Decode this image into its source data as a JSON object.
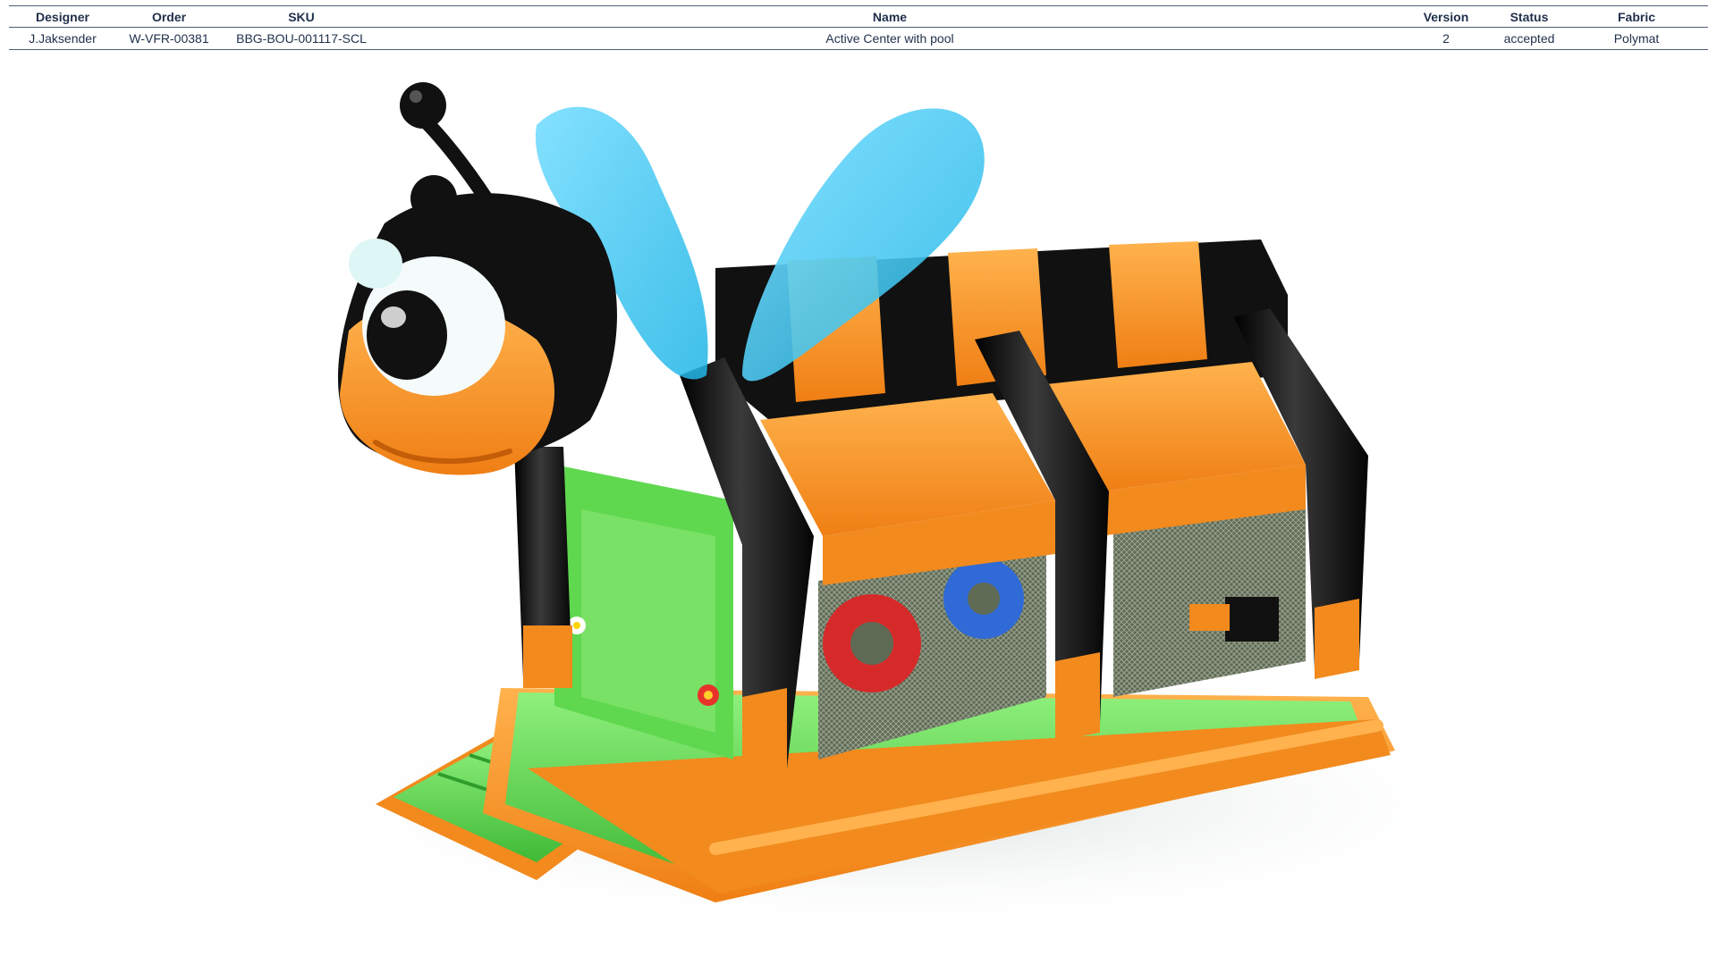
{
  "table": {
    "headers": [
      "Designer",
      "Order",
      "SKU",
      "Name",
      "Version",
      "Status",
      "Fabric"
    ],
    "row": {
      "designer": "J.Jaksender",
      "order": "W-VFR-00381",
      "sku": "BBG-BOU-001117-SCL",
      "name": "Active Center with pool",
      "version": "2",
      "status": "accepted",
      "fabric": "Polymat"
    }
  },
  "colors": {
    "orange": "#f7932a",
    "black": "#121212",
    "green": "#57d44c",
    "wing": "#44c9ef",
    "header_text": "#1f2f4a"
  },
  "icons": [
    "bee-head-icon",
    "antenna-icon",
    "wing-icon",
    "flower-icon"
  ]
}
